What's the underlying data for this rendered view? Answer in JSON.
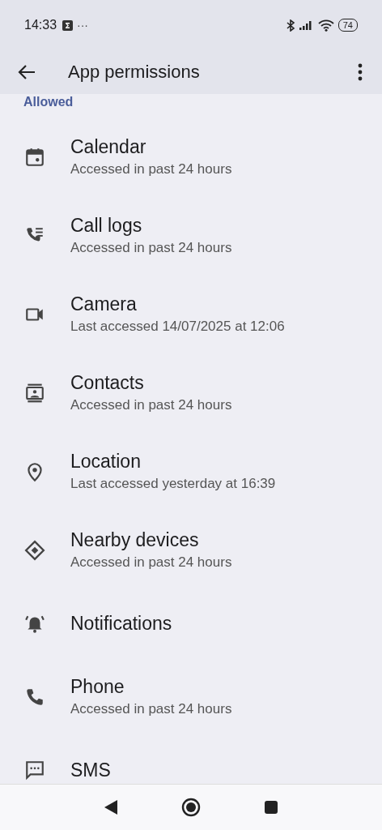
{
  "status_bar": {
    "time": "14:33",
    "more": "···",
    "battery": "74"
  },
  "app_bar": {
    "title": "App permissions"
  },
  "section": {
    "title": "Allowed"
  },
  "permissions": [
    {
      "title": "Calendar",
      "subtitle": "Accessed in past 24 hours"
    },
    {
      "title": "Call logs",
      "subtitle": "Accessed in past 24 hours"
    },
    {
      "title": "Camera",
      "subtitle": "Last accessed 14/07/2025 at 12:06"
    },
    {
      "title": "Contacts",
      "subtitle": "Accessed in past 24 hours"
    },
    {
      "title": "Location",
      "subtitle": "Last accessed yesterday at 16:39"
    },
    {
      "title": "Nearby devices",
      "subtitle": "Accessed in past 24 hours"
    },
    {
      "title": "Notifications"
    },
    {
      "title": "Phone",
      "subtitle": "Accessed in past 24 hours"
    },
    {
      "title": "SMS"
    }
  ]
}
